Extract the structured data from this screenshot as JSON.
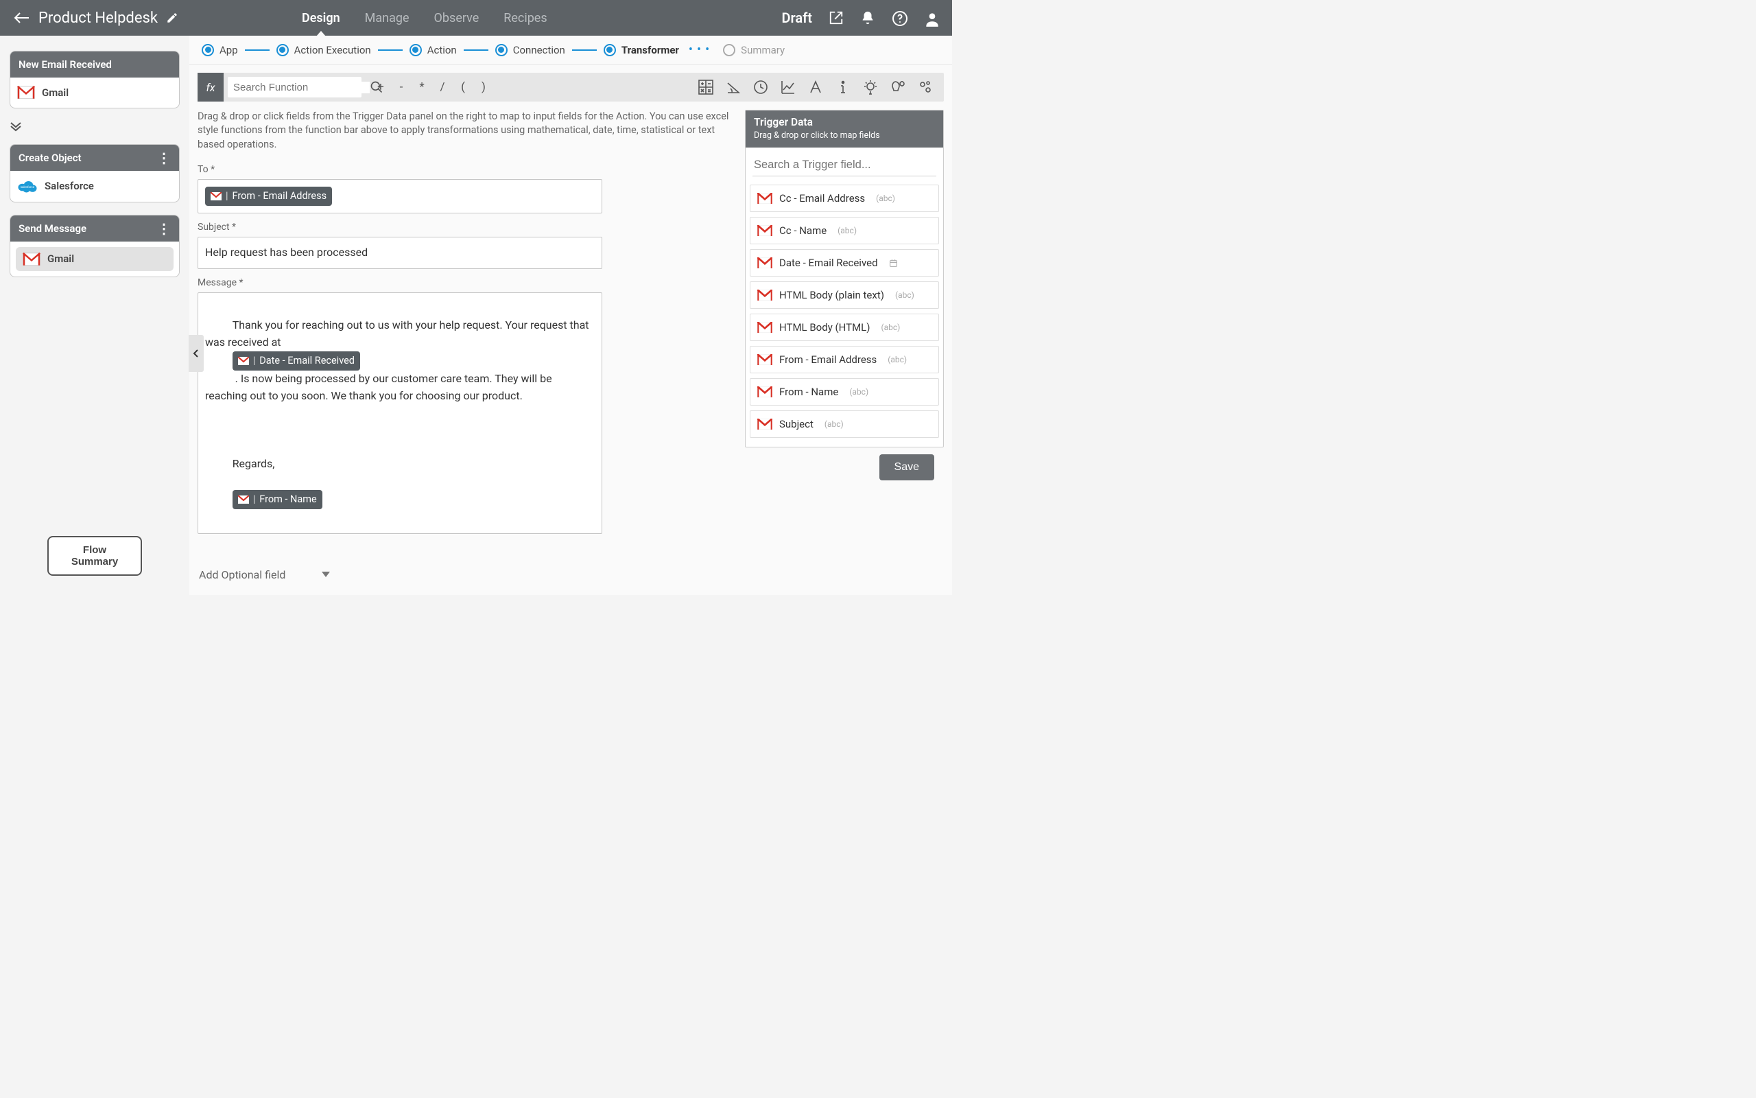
{
  "header": {
    "title": "Product Helpdesk",
    "status": "Draft"
  },
  "nav": {
    "design": "Design",
    "manage": "Manage",
    "observe": "Observe",
    "recipes": "Recipes"
  },
  "sidebar": {
    "steps": [
      {
        "title": "New Email Received",
        "app": "Gmail"
      },
      {
        "title": "Create Object",
        "app": "Salesforce"
      },
      {
        "title": "Send Message",
        "app": "Gmail"
      }
    ],
    "flow_summary": "Flow Summary"
  },
  "stepper": {
    "app": "App",
    "action_exec": "Action Execution",
    "action": "Action",
    "connection": "Connection",
    "transformer": "Transformer",
    "summary": "Summary"
  },
  "funcbar": {
    "search_placeholder": "Search Function",
    "ops": {
      "plus": "+",
      "minus": "-",
      "times": "*",
      "div": "/",
      "lparen": "(",
      "rparen": ")"
    }
  },
  "form": {
    "hint": "Drag & drop or click fields from the Trigger Data panel on the right to map to input fields for the Action. You can use excel style functions from the function bar above to apply transformations using mathematical, date, time, statistical or text based operations.",
    "to_label": "To *",
    "to_chip": "From - Email Address",
    "subject_label": "Subject *",
    "subject_value": "Help request has been processed",
    "message_label": "Message *",
    "message_parts": {
      "p1": "Thank you for reaching out to us with your help request. Your request that was received at ",
      "chip_date": "Date - Email Received",
      "p2": " . Is now being processed by our customer care team. They will be reaching out to you soon. We thank you for choosing our product.",
      "regards": "Regards,",
      "chip_from": "From - Name"
    },
    "add_optional": "Add Optional field"
  },
  "trigger": {
    "title": "Trigger Data",
    "subtitle": "Drag & drop or click to map fields",
    "search_placeholder": "Search a Trigger field...",
    "fields": [
      {
        "label": "Cc - Email Address",
        "type": "(abc)"
      },
      {
        "label": "Cc - Name",
        "type": "(abc)"
      },
      {
        "label": "Date - Email Received",
        "type": "date"
      },
      {
        "label": "HTML Body (plain text)",
        "type": "(abc)"
      },
      {
        "label": "HTML Body (HTML)",
        "type": "(abc)"
      },
      {
        "label": "From - Email Address",
        "type": "(abc)"
      },
      {
        "label": "From - Name",
        "type": "(abc)"
      },
      {
        "label": "Subject",
        "type": "(abc)"
      }
    ]
  },
  "save": "Save"
}
